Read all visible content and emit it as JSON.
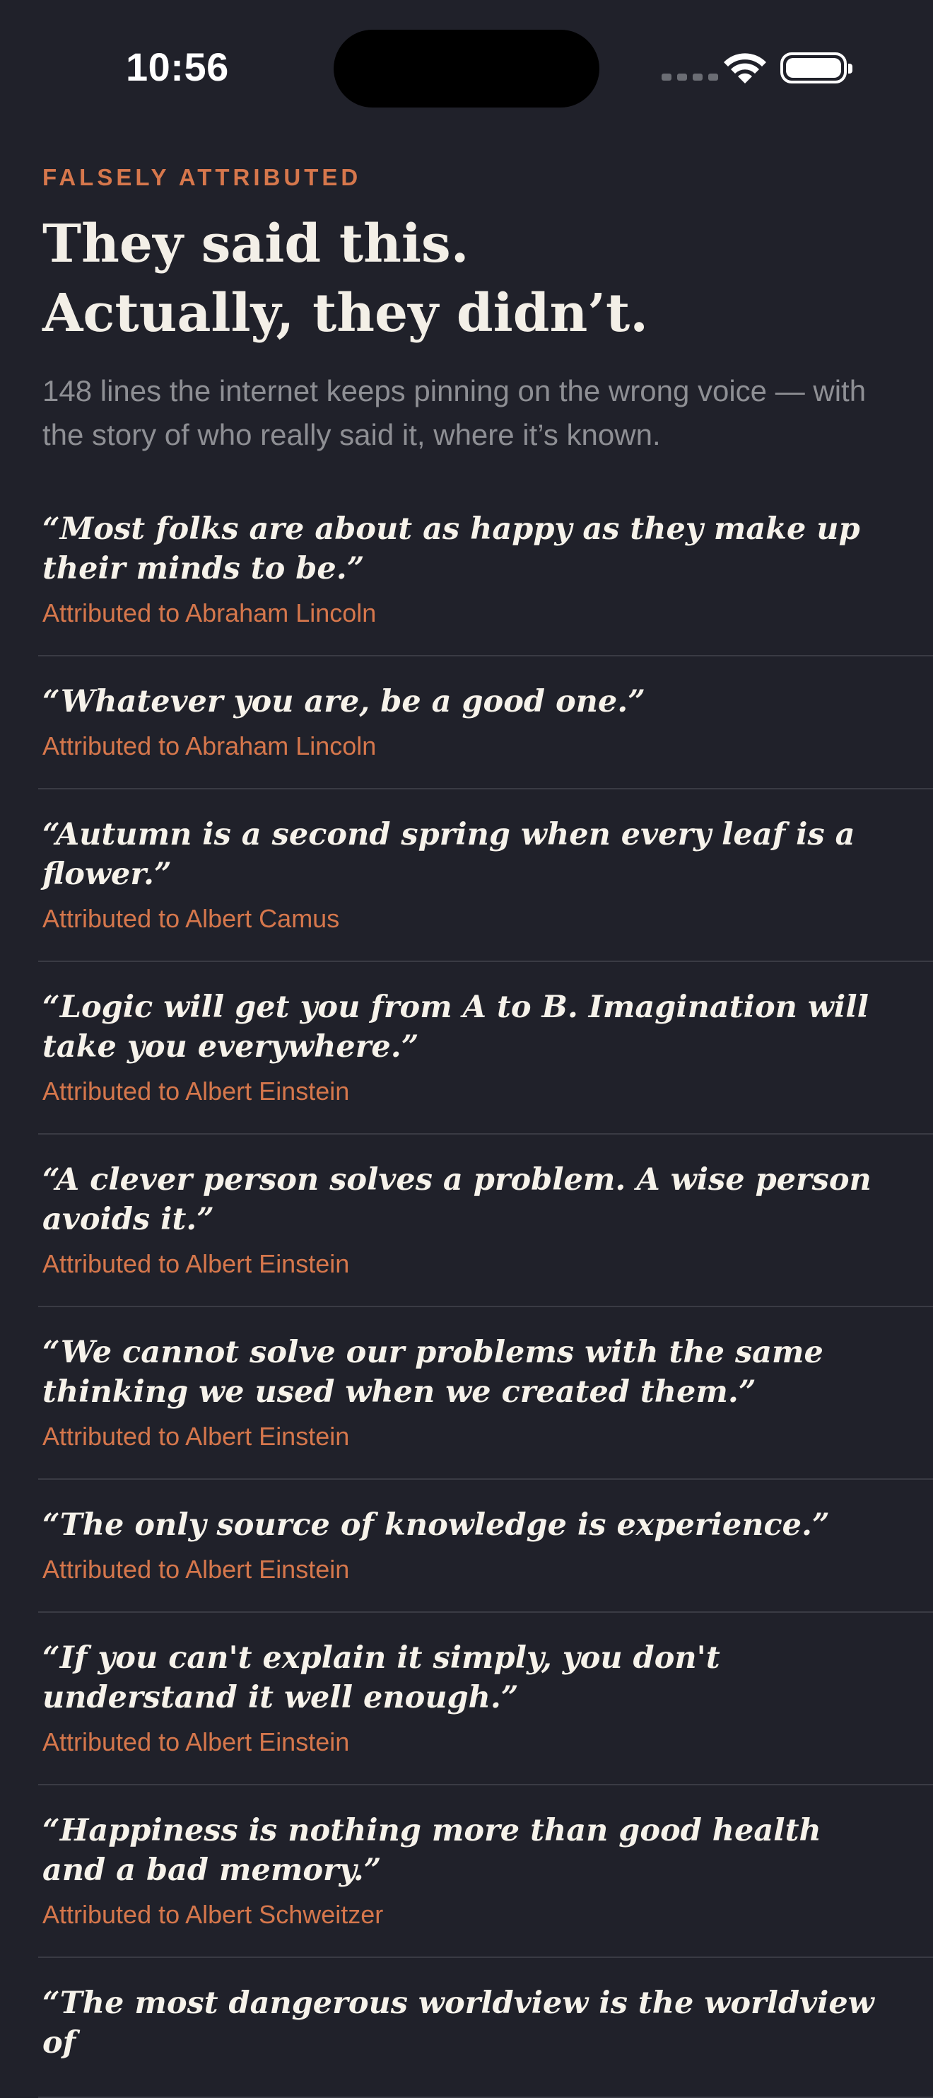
{
  "status_bar": {
    "time": "10:56"
  },
  "header": {
    "eyebrow": "FALSELY ATTRIBUTED",
    "title": "They said this. Actually, they didn’t.",
    "subtitle": "148 lines the internet keeps pinning on the wrong voice — with the story of who really said it, where it’s known."
  },
  "quotes": [
    {
      "text": "“Most folks are about as happy as they make up their minds to be.”",
      "attribution": "Attributed to Abraham Lincoln"
    },
    {
      "text": "“Whatever you are, be a good one.”",
      "attribution": "Attributed to Abraham Lincoln"
    },
    {
      "text": "“Autumn is a second spring when every leaf is a flower.”",
      "attribution": "Attributed to Albert Camus"
    },
    {
      "text": "“Logic will get you from A to B. Imagination will take you everywhere.”",
      "attribution": "Attributed to Albert Einstein"
    },
    {
      "text": "“A clever person solves a problem. A wise person avoids it.”",
      "attribution": "Attributed to Albert Einstein"
    },
    {
      "text": "“We cannot solve our problems with the same thinking we used when we created them.”",
      "attribution": "Attributed to Albert Einstein"
    },
    {
      "text": "“The only source of knowledge is experience.”",
      "attribution": "Attributed to Albert Einstein"
    },
    {
      "text": "“If you can't explain it simply, you don't understand it well enough.”",
      "attribution": "Attributed to Albert Einstein"
    },
    {
      "text": "“Happiness is nothing more than good health and a bad memory.”",
      "attribution": "Attributed to Albert Schweitzer"
    },
    {
      "text": "“The most dangerous worldview is the worldview of",
      "attribution": ""
    }
  ],
  "colors": {
    "background": "#20212a",
    "accent": "#d6774c",
    "divider": "#3a3b44"
  }
}
